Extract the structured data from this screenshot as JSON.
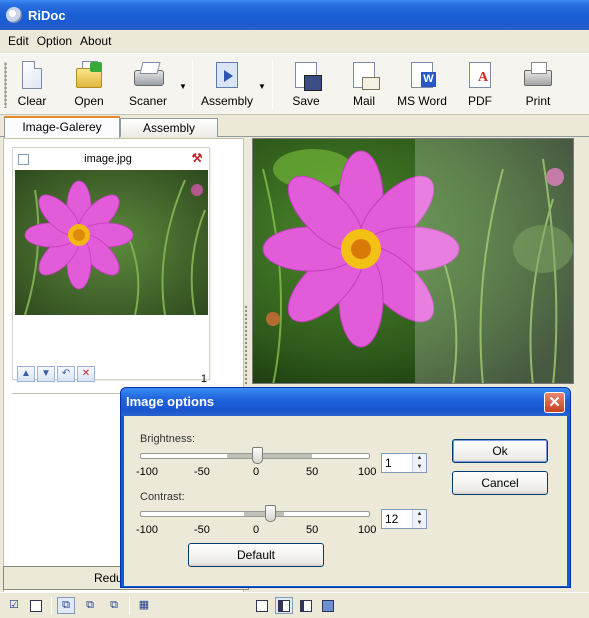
{
  "window": {
    "title": "RiDoc"
  },
  "menu": [
    "Edit",
    "Option",
    "About"
  ],
  "toolbar": {
    "clear": "Clear",
    "open": "Open",
    "scaner": "Scaner",
    "assembly": "Assembly",
    "save": "Save",
    "mail": "Mail",
    "msword": "MS Word",
    "pdf": "PDF",
    "print": "Print"
  },
  "tabs": {
    "gallery": "Image-Galerey",
    "assembly": "Assembly"
  },
  "gallery": {
    "thumb_name": "image.jpg",
    "thumb_count": "1",
    "reduce_label": "Reduce ima"
  },
  "dialog": {
    "title": "Image options",
    "brightness_label": "Brightness:",
    "brightness_value": "1",
    "contrast_label": "Contrast:",
    "contrast_value": "12",
    "ticks": [
      "-100",
      "-50",
      "0",
      "50",
      "100"
    ],
    "ok": "Ok",
    "cancel": "Cancel",
    "default": "Default"
  },
  "colors": {
    "title_blue": "#1b5fd6",
    "accent_tab": "#e68b2c",
    "flower_pink": "#e25bd8"
  },
  "icons": [
    "clear-icon",
    "open-icon",
    "scaner-icon",
    "assembly-icon",
    "save-icon",
    "mail-icon",
    "word-icon",
    "pdf-icon",
    "print-icon"
  ]
}
